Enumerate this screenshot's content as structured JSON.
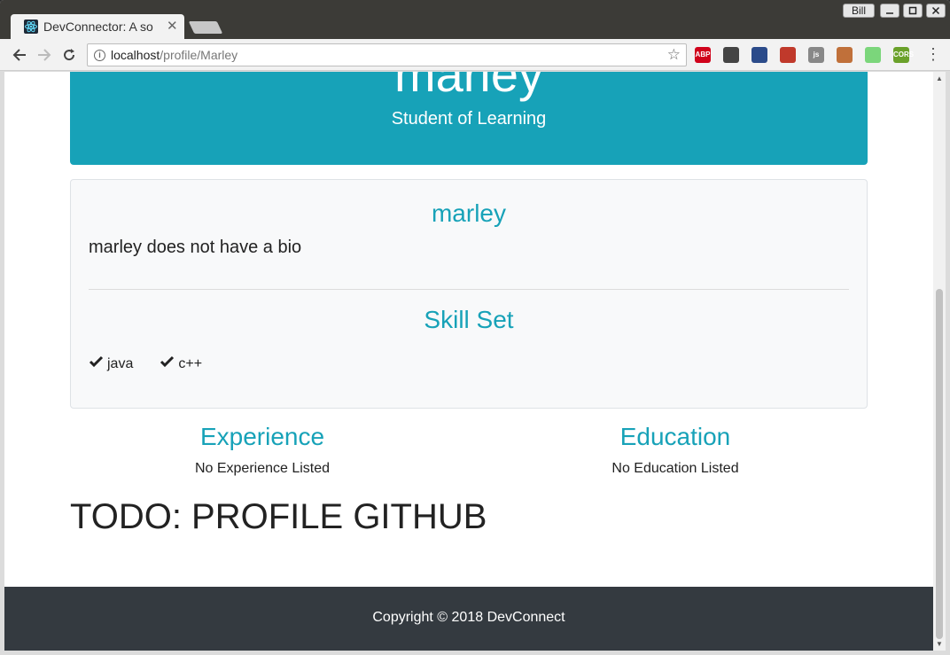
{
  "browser": {
    "tab_title": "DevConnector: A so",
    "tab_close": "✕",
    "user_label": "Bill",
    "url_host": "localhost",
    "url_path": "/profile/Marley",
    "extensions": [
      {
        "name": "abp-icon",
        "label": "ABP",
        "color": "#d0021b"
      },
      {
        "name": "extension-2-icon",
        "label": "",
        "color": "#444444"
      },
      {
        "name": "extension-3-icon",
        "label": "",
        "color": "#2b4b8a"
      },
      {
        "name": "extension-4-icon",
        "label": "",
        "color": "#c0392b"
      },
      {
        "name": "js-icon",
        "label": "js",
        "color": "#888888"
      },
      {
        "name": "extension-6-icon",
        "label": "",
        "color": "#c0703a"
      },
      {
        "name": "extension-7-icon",
        "label": "",
        "color": "#7bd67b"
      },
      {
        "name": "cors-icon",
        "label": "CORS",
        "color": "#6aa12a"
      }
    ]
  },
  "profile": {
    "header_name": "marley",
    "status": "Student of Learning",
    "about_name": "marley",
    "bio": "marley does not have a bio",
    "skill_heading": "Skill Set",
    "skills": [
      "java",
      "c++"
    ],
    "experience_heading": "Experience",
    "experience_empty": "No Experience Listed",
    "education_heading": "Education",
    "education_empty": "No Education Listed",
    "todo": "TODO: PROFILE GITHUB"
  },
  "footer": {
    "copyright": "Copyright © 2018 DevConnect"
  },
  "colors": {
    "accent": "#17a2b8",
    "footer_bg": "#343a40"
  }
}
